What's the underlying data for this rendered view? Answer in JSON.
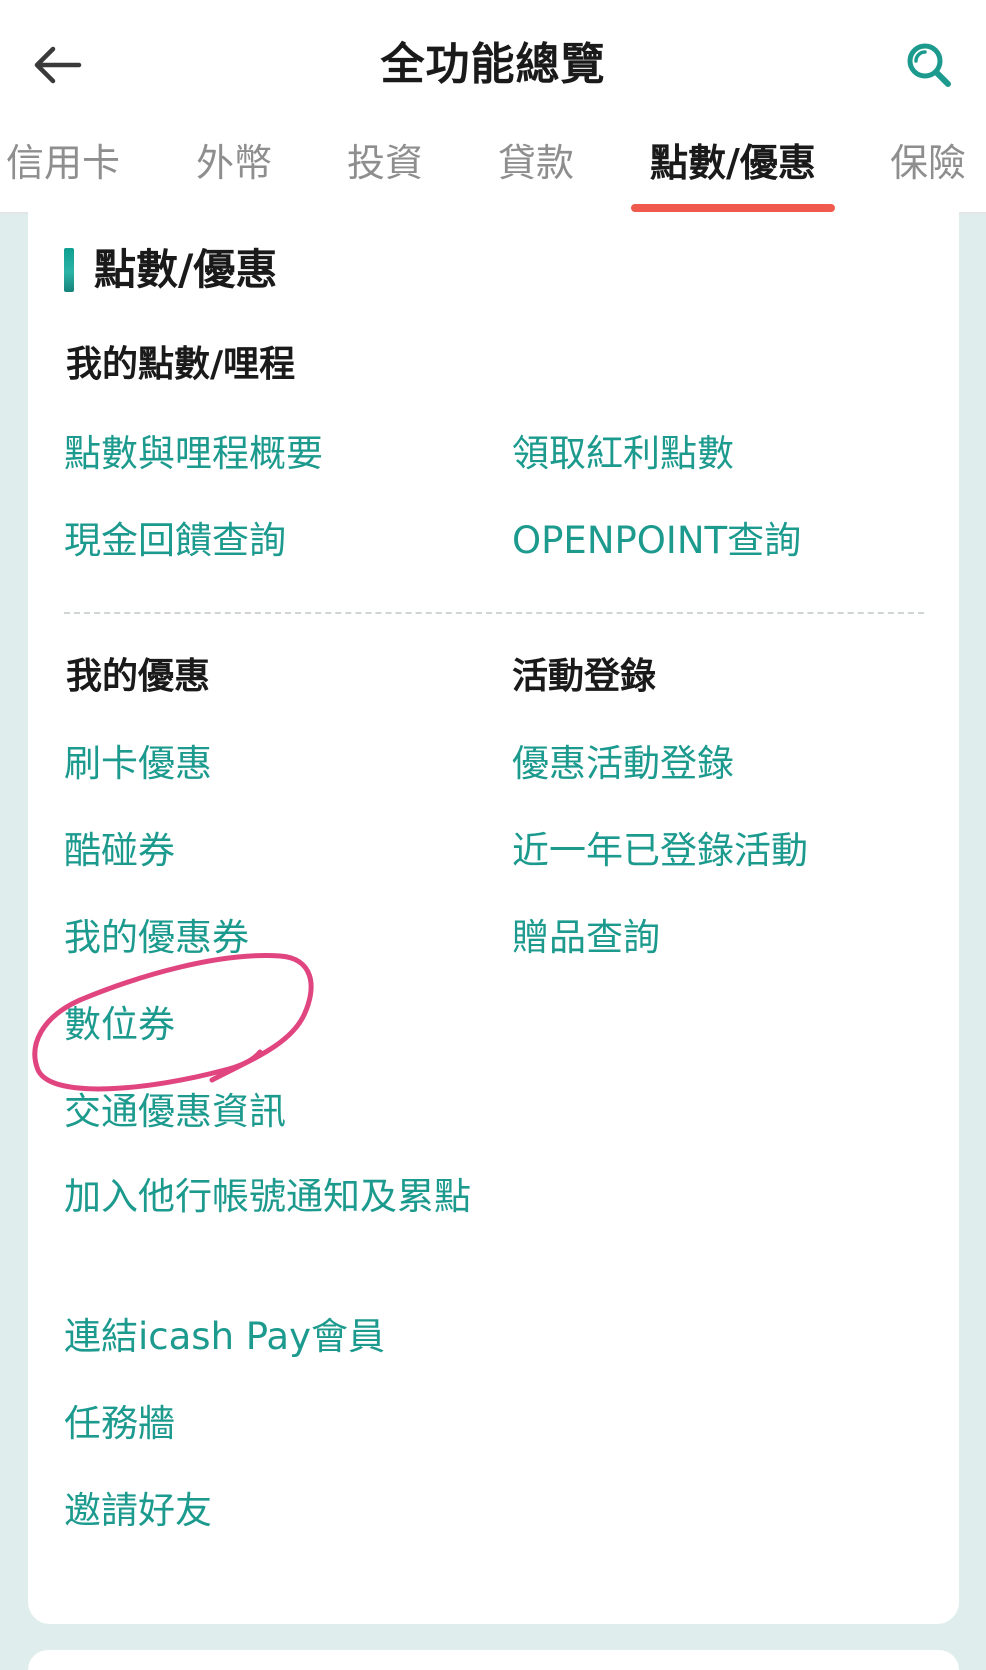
{
  "header": {
    "title": "全功能總覽"
  },
  "tabs": [
    {
      "label": "信用卡",
      "active": false
    },
    {
      "label": "外幣",
      "active": false
    },
    {
      "label": "投資",
      "active": false
    },
    {
      "label": "貸款",
      "active": false
    },
    {
      "label": "點數/優惠",
      "active": true
    },
    {
      "label": "保險",
      "active": false
    }
  ],
  "section": {
    "title": "點數/優惠",
    "points_group": {
      "heading": "我的點數/哩程",
      "links": [
        "點數與哩程概要",
        "領取紅利點數",
        "現金回饋查詢",
        "OPENPOINT查詢"
      ]
    },
    "offers_group": {
      "heading": "我的優惠",
      "links": [
        "刷卡優惠",
        "酷碰券",
        "我的優惠券",
        "數位券",
        "交通優惠資訊",
        "加入他行帳號通知及累點",
        "連結icash Pay會員",
        "任務牆",
        "邀請好友"
      ]
    },
    "events_group": {
      "heading": "活動登錄",
      "links": [
        "優惠活動登錄",
        "近一年已登錄活動",
        "贈品查詢"
      ]
    }
  },
  "colors": {
    "accent": "#1c9a8e",
    "tab_indicator": "#ef5a4d",
    "annotation": "#e0457f",
    "background": "#dfeeec"
  },
  "icons": {
    "back": "arrow-left-icon",
    "search": "search-icon"
  }
}
